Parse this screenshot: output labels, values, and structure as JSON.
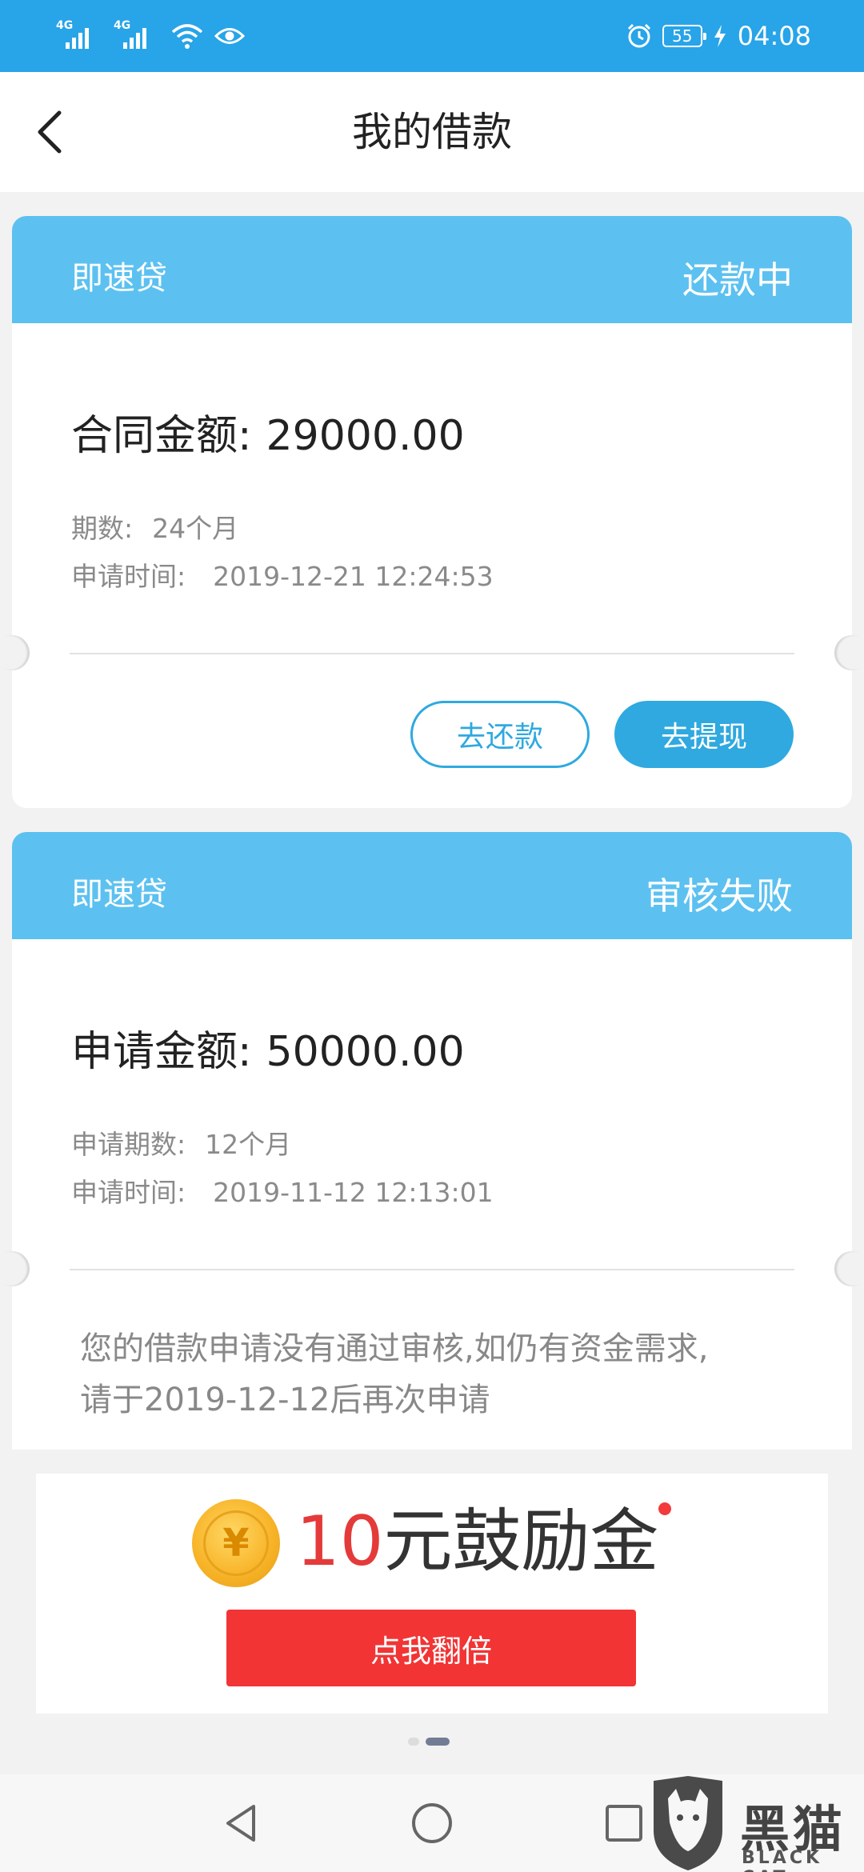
{
  "status_bar": {
    "signal_1_label": "4G",
    "signal_2_label": "4G",
    "battery": "55",
    "time": "04:08"
  },
  "header": {
    "title": "我的借款"
  },
  "loans": [
    {
      "product": "即速贷",
      "status": "还款中",
      "amount_label": "合同金额:",
      "amount": "29000.00",
      "term_label": "期数:",
      "term": "24个月",
      "time_label": "申请时间:",
      "time": "2019-12-21 12:24:53",
      "repay_button": "去还款",
      "withdraw_button": "去提现"
    },
    {
      "product": "即速贷",
      "status": "审核失败",
      "amount_label": "申请金额:",
      "amount": "50000.00",
      "term_label": "申请期数:",
      "term": "12个月",
      "time_label": "申请时间:",
      "time": "2019-11-12 12:13:01",
      "notice_line1": "您的借款申请没有通过审核,如仍有资金需求,",
      "notice_line2": "请于2019-12-12后再次申请"
    }
  ],
  "banner": {
    "coin_symbol": "¥",
    "amount": "10",
    "title_suffix": "元鼓励金",
    "button": "点我翻倍"
  },
  "pager": {
    "count": 2,
    "active_index": 1
  },
  "watermark": {
    "text": "黑猫",
    "sub": "BLACK CAT"
  },
  "colors": {
    "status_bar": "#28a4e8",
    "card_header": "#5cc1f0",
    "accent": "#2fa9df",
    "banner_button": "#f23434",
    "amount_red": "#e43a3a"
  }
}
